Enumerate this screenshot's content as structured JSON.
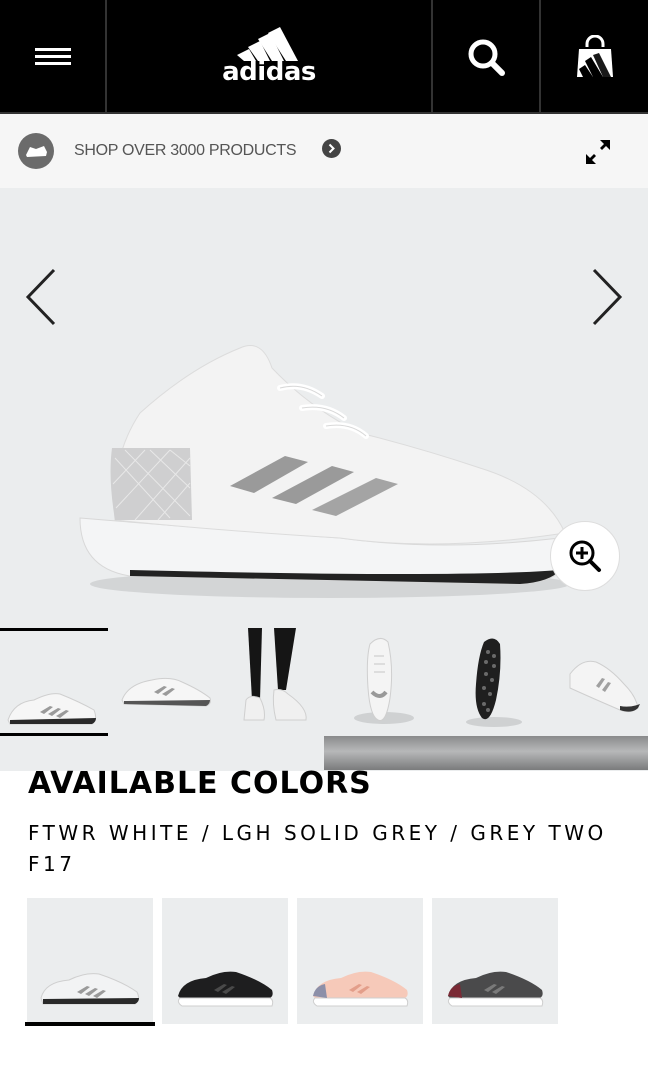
{
  "header": {
    "logo_text": "adidas",
    "menu_icon": "hamburger-menu-icon",
    "search_icon": "search-icon",
    "bag_icon": "shopping-bag-icon"
  },
  "promo": {
    "text": "SHOP OVER 3000 PRODUCTS",
    "badge_icon": "shoe-badge-icon",
    "arrow_icon": "chevron-right-circle-icon",
    "expand_icon": "expand-icon"
  },
  "hero": {
    "prev_icon": "chevron-left-icon",
    "next_icon": "chevron-right-icon",
    "zoom_icon": "zoom-in-icon"
  },
  "thumbnails": [
    {
      "view": "side-view",
      "active": true
    },
    {
      "view": "side-view-2"
    },
    {
      "view": "on-feet"
    },
    {
      "view": "top-view"
    },
    {
      "view": "sole-view"
    },
    {
      "view": "angle-view"
    }
  ],
  "colors": {
    "title": "AVAILABLE COLORS",
    "selected_name": "FTWR WHITE / LGH SOLID GREY / GREY TWO F17",
    "swatches": [
      {
        "color": "white",
        "upper": "#f2f3f4",
        "stripe": "#9a9a9a",
        "sole": "#ffffff"
      },
      {
        "color": "black",
        "upper": "#1e1e1f",
        "stripe": "#4a4a4a",
        "sole": "#ffffff"
      },
      {
        "color": "pink",
        "upper": "#f6c9b9",
        "stripe": "#e8a896",
        "sole": "#ffffff"
      },
      {
        "color": "grey",
        "upper": "#4a4a4b",
        "stripe": "#6e6e6e",
        "sole": "#ffffff"
      }
    ]
  },
  "colors_theme": {
    "header_bg": "#000000",
    "promo_bg": "#f6f6f6",
    "image_bg": "#ebedee"
  }
}
